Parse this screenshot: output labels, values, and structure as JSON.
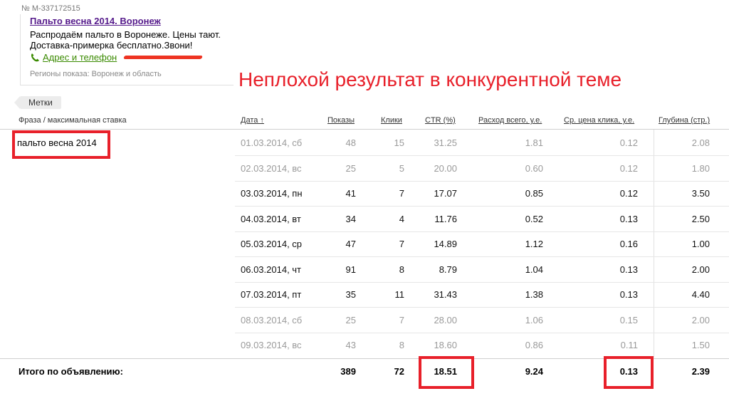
{
  "ad": {
    "id": "№ M-337172515",
    "title": "Пальто весна 2014. Воронеж",
    "text_line1": "Распродаём пальто в Воронеже. Цены тают.",
    "text_line2": "Доставка-примерка бесплатно.Звони!",
    "contact_link": "Адрес и телефон",
    "regions": "Регионы показа: Воронеж и область"
  },
  "annotation": "Неплохой результат в конкурентной теме",
  "tags_button": "Метки",
  "table": {
    "headers": {
      "phrase": "Фраза / максимальная ставка",
      "date": "Дата ↑",
      "shows": "Показы",
      "clicks": "Клики",
      "ctr": "CTR (%)",
      "spend": "Расход всего, у.е.",
      "cpc": "Ср. цена клика, у.е.",
      "depth": "Глубина (стр.)"
    },
    "phrase": "пальто весна 2014",
    "rows": [
      {
        "date": "01.03.2014, сб",
        "shows": "48",
        "clicks": "15",
        "ctr": "31.25",
        "spend": "1.81",
        "cpc": "0.12",
        "depth": "2.08",
        "weekend": true
      },
      {
        "date": "02.03.2014, вс",
        "shows": "25",
        "clicks": "5",
        "ctr": "20.00",
        "spend": "0.60",
        "cpc": "0.12",
        "depth": "1.80",
        "weekend": true
      },
      {
        "date": "03.03.2014, пн",
        "shows": "41",
        "clicks": "7",
        "ctr": "17.07",
        "spend": "0.85",
        "cpc": "0.12",
        "depth": "3.50",
        "weekend": false
      },
      {
        "date": "04.03.2014, вт",
        "shows": "34",
        "clicks": "4",
        "ctr": "11.76",
        "spend": "0.52",
        "cpc": "0.13",
        "depth": "2.50",
        "weekend": false
      },
      {
        "date": "05.03.2014, ср",
        "shows": "47",
        "clicks": "7",
        "ctr": "14.89",
        "spend": "1.12",
        "cpc": "0.16",
        "depth": "1.00",
        "weekend": false
      },
      {
        "date": "06.03.2014, чт",
        "shows": "91",
        "clicks": "8",
        "ctr": "8.79",
        "spend": "1.04",
        "cpc": "0.13",
        "depth": "2.00",
        "weekend": false
      },
      {
        "date": "07.03.2014, пт",
        "shows": "35",
        "clicks": "11",
        "ctr": "31.43",
        "spend": "1.38",
        "cpc": "0.13",
        "depth": "4.40",
        "weekend": false
      },
      {
        "date": "08.03.2014, сб",
        "shows": "25",
        "clicks": "7",
        "ctr": "28.00",
        "spend": "1.06",
        "cpc": "0.15",
        "depth": "2.00",
        "weekend": true
      },
      {
        "date": "09.03.2014, вс",
        "shows": "43",
        "clicks": "8",
        "ctr": "18.60",
        "spend": "0.86",
        "cpc": "0.11",
        "depth": "1.50",
        "weekend": true
      }
    ],
    "total": {
      "label": "Итого по объявлению:",
      "shows": "389",
      "clicks": "72",
      "ctr": "18.51",
      "spend": "9.24",
      "cpc": "0.13",
      "depth": "2.39"
    }
  },
  "colors": {
    "highlight": "#e8202a",
    "title_link": "#551a8b",
    "contact_link": "#3a8a00",
    "weekend_text": "#9a9a9a"
  }
}
